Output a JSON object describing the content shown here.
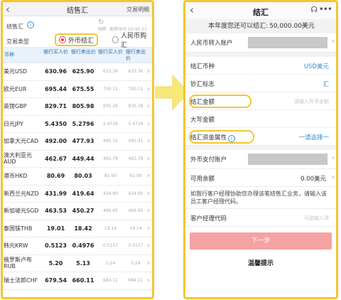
{
  "left": {
    "header": {
      "title": "结售汇",
      "trade_detail": "交易明细"
    },
    "rate_label": "结售汇",
    "refresh_label": "刷新",
    "update_time": "更新时间 20:40:21",
    "trade_type_label": "交易类型",
    "options": [
      "外币结汇",
      "人民币购汇"
    ],
    "selected_option": "外币结汇",
    "columns": [
      "币种",
      "银行买入价",
      "银行卖出价",
      "银行买入价",
      "银行卖出价"
    ],
    "rows": [
      {
        "ccy": "美元USD",
        "buy": "630.96",
        "sell": "625.90",
        "cash_buy": "633.36",
        "cash_sell": "633.36"
      },
      {
        "ccy": "欧元EUR",
        "buy": "695.44",
        "sell": "675.55",
        "cash_buy": "700.11",
        "cash_sell": "700.11"
      },
      {
        "ccy": "英镑GBP",
        "buy": "829.71",
        "sell": "805.98",
        "cash_buy": "835.28",
        "cash_sell": "835.28"
      },
      {
        "ccy": "日元JPY",
        "buy": "5.4350",
        "sell": "5.2796",
        "cash_buy": "5.4716",
        "cash_sell": "5.4716"
      },
      {
        "ccy": "加拿大元CAD",
        "buy": "492.00",
        "sell": "477.93",
        "cash_buy": "495.31",
        "cash_sell": "495.31"
      },
      {
        "ccy": "澳大利亚元AUD",
        "buy": "462.67",
        "sell": "449.44",
        "cash_buy": "465.79",
        "cash_sell": "465.79"
      },
      {
        "ccy": "港币HKD",
        "buy": "80.69",
        "sell": "80.03",
        "cash_buy": "81.00",
        "cash_sell": "81.00"
      },
      {
        "ccy": "新西兰元NZD",
        "buy": "431.99",
        "sell": "419.64",
        "cash_buy": "434.90",
        "cash_sell": "434.90"
      },
      {
        "ccy": "新加坡元SGD",
        "buy": "463.53",
        "sell": "450.27",
        "cash_buy": "466.65",
        "cash_sell": "466.65"
      },
      {
        "ccy": "泰国铢THB",
        "buy": "19.01",
        "sell": "18.42",
        "cash_buy": "19.14",
        "cash_sell": "19.14"
      },
      {
        "ccy": "韩元KRW",
        "buy": "0.5123",
        "sell": "0.4976",
        "cash_buy": "0.5157",
        "cash_sell": "0.5157"
      },
      {
        "ccy": "俄罗斯卢布RUB",
        "buy": "5.20",
        "sell": "5.13",
        "cash_buy": "5.24",
        "cash_sell": "5.24"
      },
      {
        "ccy": "瑞士法郎CHF",
        "buy": "679.54",
        "sell": "660.11",
        "cash_buy": "684.11",
        "cash_sell": "684.11"
      }
    ]
  },
  "right": {
    "header": {
      "title": "结汇"
    },
    "quota_text": "本年度您还可以结汇:",
    "quota_amount": "50,000.00美元",
    "rmb_account_label": "人民币转入账户",
    "currency_label": "结汇币种",
    "currency_value": "USD美元",
    "cash_flag_label": "钞汇标志",
    "cash_flag_value": "汇",
    "amount_label": "结汇金额",
    "amount_placeholder": "请输入外币金额",
    "amount_upper_label": "大写金额",
    "fund_attr_label": "结汇资金属性",
    "fund_attr_value": "一请选择一",
    "fx_account_label": "外币支付账户",
    "balance_label": "可用余额",
    "balance_value": "0.00美元",
    "note": "如我行客户经理协助您办理该笔结售汇业务，请输入该员工客户经理代码。",
    "manager_label": "客户经理代码",
    "manager_placeholder": "可选输入项",
    "next_button": "下一步",
    "tips": "温馨提示"
  },
  "colors": {
    "highlight": "#f5c531",
    "accent_blue": "#2f8fd8",
    "radio_red": "#e94545",
    "next_button": "#f5a2a2"
  }
}
